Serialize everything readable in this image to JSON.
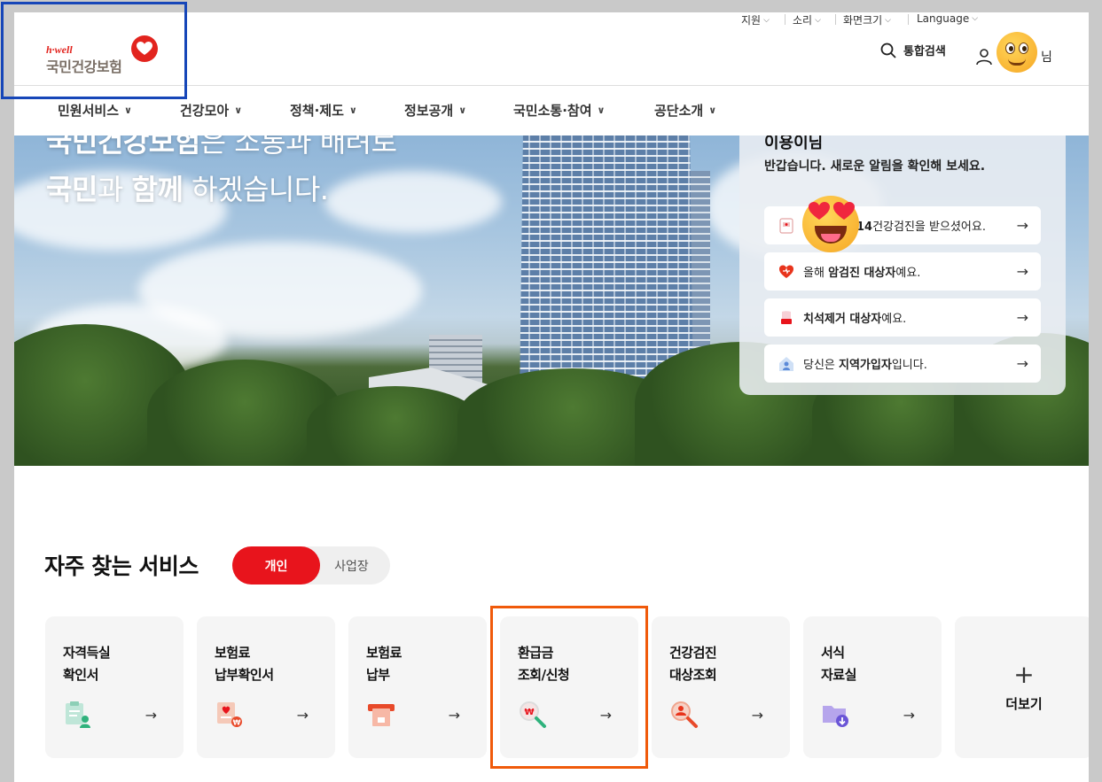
{
  "utility": [
    "지원",
    "소리",
    "화면크기",
    "Language"
  ],
  "logo": {
    "small": "h·well",
    "main": "국민건강보험"
  },
  "header": {
    "search_label": "통합검색",
    "user_suffix": "님"
  },
  "gnb": [
    "민원서비스",
    "건강모아",
    "정책·제도",
    "정보공개",
    "국민소통·참여",
    "공단소개"
  ],
  "hero": {
    "line1_a": "국민건강보험",
    "line1_b": "은 소통과 배려로",
    "line2_a": "국민",
    "line2_b": "과 ",
    "line2_c": "함께",
    "line2_d": " 하겠습니다."
  },
  "notice": {
    "name": "이용이님",
    "greeting": "반갑습니다. 새로운 알림을 확인해 보세요.",
    "items": [
      {
        "bold": "14",
        "text": "건강검진을 받으셨어요.",
        "icon": "checkup-icon"
      },
      {
        "pre": "올해 ",
        "bold": "암검진 대상자",
        "text": "예요.",
        "icon": "heart-icon"
      },
      {
        "pre": "",
        "bold": "치석제거 대상자",
        "text": "예요.",
        "icon": "tooth-icon"
      },
      {
        "pre": "당신은 ",
        "bold": "지역가입자",
        "text": "입니다.",
        "icon": "person-icon"
      }
    ],
    "arrow": "→"
  },
  "services": {
    "title": "자주 찾는 서비스",
    "toggle_on": "개인",
    "toggle_off": "사업장",
    "cards": [
      {
        "line1": "자격득실",
        "line2": "확인서",
        "icon": "certificate-icon"
      },
      {
        "line1": "보험료",
        "line2": "납부확인서",
        "icon": "payment-receipt-icon"
      },
      {
        "line1": "보험료",
        "line2": "납부",
        "icon": "card-payment-icon"
      },
      {
        "line1": "환급금",
        "line2": "조회/신청",
        "icon": "refund-search-icon"
      },
      {
        "line1": "건강검진",
        "line2": "대상조회",
        "icon": "checkup-search-icon"
      },
      {
        "line1": "서식",
        "line2": "자료실",
        "icon": "download-folder-icon"
      }
    ],
    "more_plus": "+",
    "more_label": "더보기",
    "arrow": "→"
  },
  "colors": {
    "brand_red": "#e8141c",
    "highlight_blue": "#1646b8",
    "highlight_orange": "#f05a0a"
  }
}
